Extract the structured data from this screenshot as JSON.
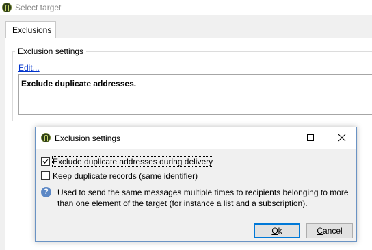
{
  "window": {
    "title": "Select target"
  },
  "tabs": [
    {
      "label": "Exclusions"
    }
  ],
  "exclusion_group": {
    "legend": "Exclusion settings",
    "edit_link": "Edit...",
    "summary": "Exclude duplicate addresses."
  },
  "dialog": {
    "title": "Exclusion settings",
    "checkboxes": [
      {
        "label": "Exclude duplicate addresses during delivery",
        "checked": true
      },
      {
        "label": "Keep duplicate records (same identifier)",
        "checked": false
      }
    ],
    "info": "Used to send the same messages multiple times to recipients belonging to more than one element of the target (for instance a list and a subscription).",
    "ok_mnemonic": "O",
    "ok_rest": "k",
    "cancel_mnemonic": "C",
    "cancel_rest": "ancel"
  },
  "icons": {
    "app": "app-logo-icon",
    "minimize": "minimize-icon",
    "maximize": "maximize-icon",
    "close": "close-icon",
    "info": "info-icon",
    "check": "checkmark-icon"
  },
  "colors": {
    "link": "#0033cc",
    "accent": "#0078d7",
    "info": "#5b87c5"
  }
}
